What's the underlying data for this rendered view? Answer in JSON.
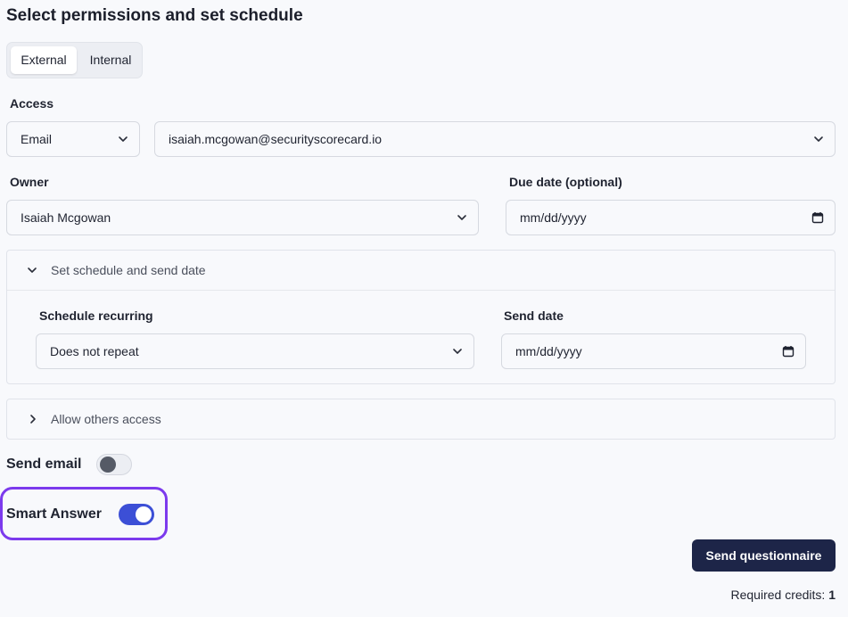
{
  "title": "Select permissions and set schedule",
  "tabs": [
    {
      "label": "External",
      "active": true
    },
    {
      "label": "Internal",
      "active": false
    }
  ],
  "access": {
    "label": "Access",
    "method": "Email",
    "email": "isaiah.mcgowan@securityscorecard.io"
  },
  "owner": {
    "label": "Owner",
    "value": "Isaiah Mcgowan"
  },
  "due_date": {
    "label": "Due date (optional)",
    "value": "mm/dd/yyyy"
  },
  "schedule_panel": {
    "title": "Set schedule and send date",
    "expanded": true,
    "recurring_label": "Schedule recurring",
    "recurring_value": "Does not repeat",
    "send_date_label": "Send date",
    "send_date_value": "mm/dd/yyyy"
  },
  "access_panel": {
    "title": "Allow others access",
    "expanded": false
  },
  "send_email": {
    "label": "Send email",
    "on": false
  },
  "smart_answer": {
    "label": "Smart Answer",
    "on": true
  },
  "send_button": "Send questionnaire",
  "credits": {
    "label": "Required credits:",
    "value": "1"
  },
  "colors": {
    "accent": "#3c4fd6",
    "highlight": "#7c3aed",
    "button": "#1d2548"
  }
}
